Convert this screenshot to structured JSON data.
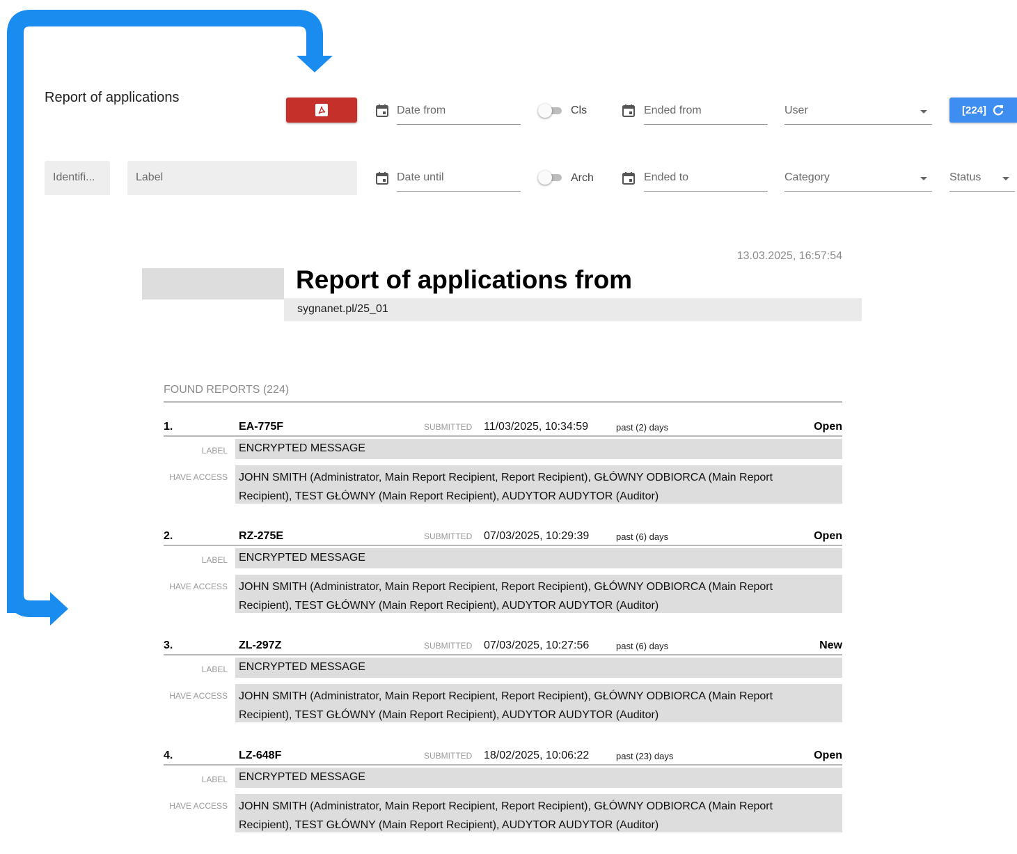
{
  "toolbar": {
    "title": "Report of applications",
    "date_from": "Date from",
    "date_until": "Date until",
    "cls_label": "Cls",
    "arch_label": "Arch",
    "ended_from": "Ended from",
    "ended_to": "Ended to",
    "user": "User",
    "category": "Category",
    "status": "Status",
    "refresh_label": "[224]",
    "identifier_placeholder": "Identifi...",
    "label_placeholder": "Label",
    "pdf_color": "#c6302b",
    "accent_color": "#3d8ef0"
  },
  "report": {
    "timestamp": "13.03.2025, 16:57:54",
    "title": "Report of applications from",
    "subtitle": "sygnanet.pl/25_01",
    "found": "FOUND REPORTS (224)",
    "submitted_caption": "SUBMITTED",
    "label_caption": "LABEL",
    "access_caption": "HAVE ACCESS",
    "entries": [
      {
        "num": "1.",
        "id": "EA-775F",
        "date": "11/03/2025, 10:34:59",
        "past": "past (2) days",
        "status": "Open",
        "label": "ENCRYPTED MESSAGE",
        "access": "JOHN SMITH (Administrator, Main Report Recipient, Report Recipient), GŁÓWNY ODBIORCA (Main Report Recipient), TEST GŁÓWNY (Main Report Recipient), AUDYTOR AUDYTOR (Auditor)"
      },
      {
        "num": "2.",
        "id": "RZ-275E",
        "date": "07/03/2025, 10:29:39",
        "past": "past (6) days",
        "status": "Open",
        "label": "ENCRYPTED MESSAGE",
        "access": "JOHN SMITH (Administrator, Main Report Recipient, Report Recipient), GŁÓWNY ODBIORCA (Main Report Recipient), TEST GŁÓWNY (Main Report Recipient), AUDYTOR AUDYTOR (Auditor)"
      },
      {
        "num": "3.",
        "id": "ZL-297Z",
        "date": "07/03/2025, 10:27:56",
        "past": "past (6) days",
        "status": "New",
        "label": "ENCRYPTED MESSAGE",
        "access": "JOHN SMITH (Administrator, Main Report Recipient, Report Recipient), GŁÓWNY ODBIORCA (Main Report Recipient), TEST GŁÓWNY (Main Report Recipient), AUDYTOR AUDYTOR (Auditor)"
      },
      {
        "num": "4.",
        "id": "LZ-648F",
        "date": "18/02/2025, 10:06:22",
        "past": "past (23) days",
        "status": "Open",
        "label": "ENCRYPTED MESSAGE",
        "access": "JOHN SMITH (Administrator, Main Report Recipient, Report Recipient), GŁÓWNY ODBIORCA (Main Report Recipient), TEST GŁÓWNY (Main Report Recipient), AUDYTOR AUDYTOR (Auditor)"
      }
    ]
  }
}
